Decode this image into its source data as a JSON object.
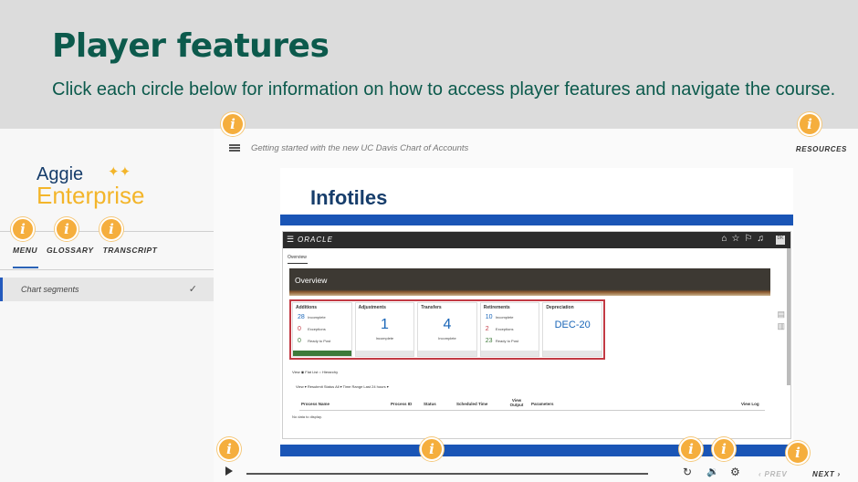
{
  "heading": {
    "title": "Player features",
    "subtitle": "Click each circle below for information on how to access player features and navigate the course."
  },
  "sidebar": {
    "logo_line1": "Aggie",
    "logo_line2": "Enterprise",
    "tabs": [
      "MENU",
      "GLOSSARY",
      "TRANSCRIPT"
    ],
    "items": [
      {
        "label": "Chart segments",
        "checked": true
      }
    ]
  },
  "topbar": {
    "course_title": "Getting started with the new UC Davis Chart of Accounts",
    "resources_label": "RESOURCES"
  },
  "slide": {
    "title": "Infotiles",
    "screenshot": {
      "brand": "ORACLE",
      "user_initials": "DK",
      "tab": "Overview",
      "panel_title": "Overview",
      "cards": [
        {
          "title": "Additions",
          "rows": [
            {
              "value": "28",
              "label": "Incomplete",
              "color": "#1a66b8"
            },
            {
              "value": "0",
              "label": "Exceptions",
              "color": "#c23a44"
            },
            {
              "value": "0",
              "label": "Ready to Post",
              "color": "#3e7a3a"
            }
          ]
        },
        {
          "title": "Adjustments",
          "big": "1",
          "sub": "Incomplete"
        },
        {
          "title": "Transfers",
          "big": "4",
          "sub": "Incomplete"
        },
        {
          "title": "Retirements",
          "rows": [
            {
              "value": "10",
              "label": "Incomplete",
              "color": "#1a66b8"
            },
            {
              "value": "2",
              "label": "Exceptions",
              "color": "#c23a44"
            },
            {
              "value": "23",
              "label": "Ready to Post",
              "color": "#3e7a3a"
            }
          ]
        },
        {
          "title": "Depreciation",
          "big_text": "DEC-20"
        }
      ],
      "view_line": "View   ◉ Flat List   ○ Hierarchy",
      "tools_line": "View ▾    Resubmit   Status  All           ▾    Time Range  Last 24 hours ▾",
      "columns": [
        "Process Name",
        "Process ID",
        "Status",
        "Scheduled Time",
        "View Output",
        "Parameters",
        "View Log"
      ],
      "empty_text": "No data to display."
    }
  },
  "controls": {
    "prev_label": "‹ PREV",
    "next_label": "NEXT ›",
    "progress": 0.0
  },
  "colors": {
    "heading": "#0c5a4c",
    "info_circle": "#f5ae3d",
    "slide_bar": "#1a55b6",
    "logo_blue": "#163d6b",
    "logo_gold": "#f3b52a"
  },
  "icons": {
    "info": "i",
    "menu": "hamburger-icon",
    "replay": "↻",
    "volume": "🔉",
    "settings": "⚙",
    "check": "✓"
  }
}
